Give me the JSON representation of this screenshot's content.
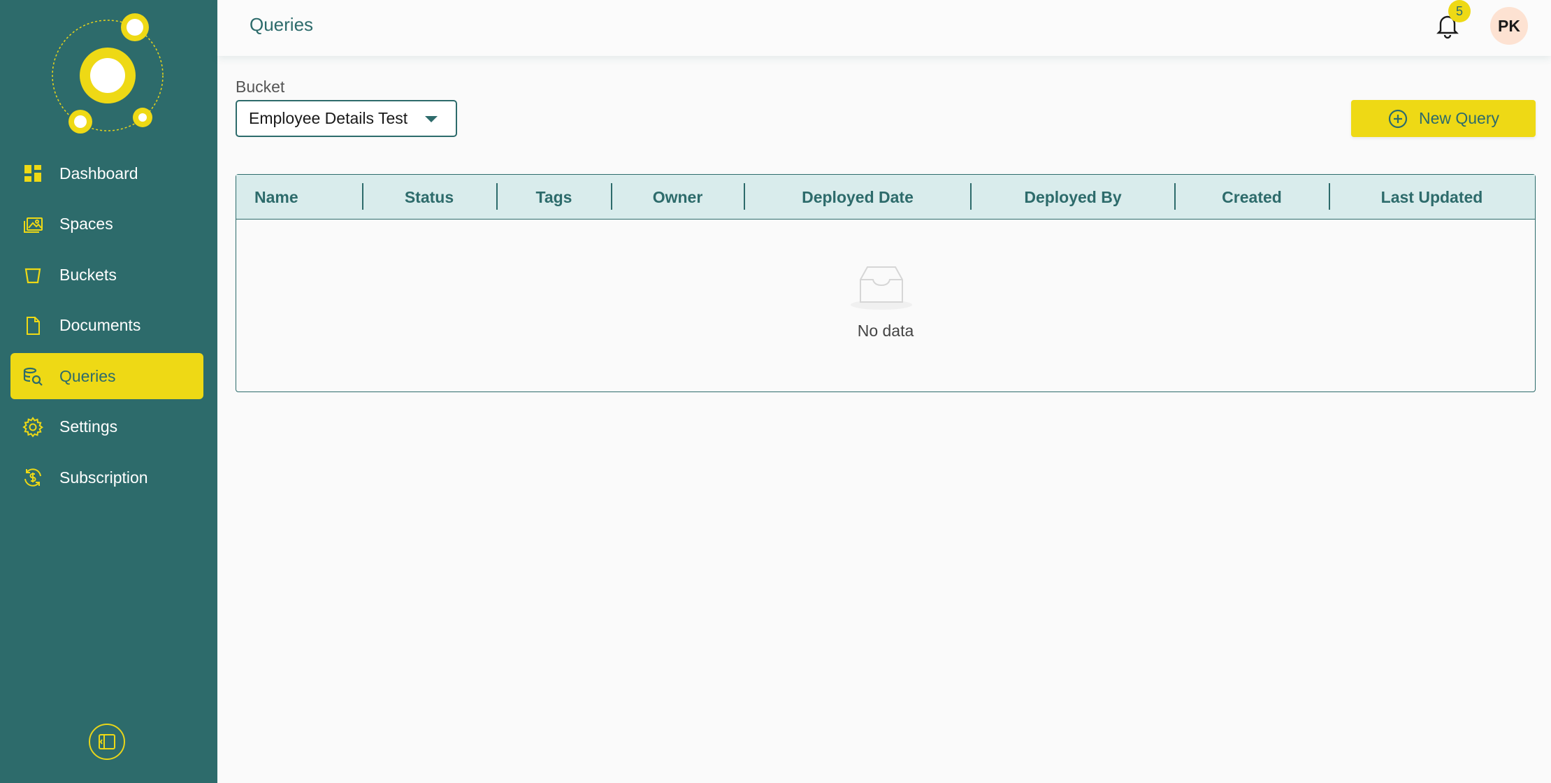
{
  "sidebar": {
    "items": [
      {
        "label": "Dashboard",
        "icon": "dashboard-icon"
      },
      {
        "label": "Spaces",
        "icon": "spaces-icon"
      },
      {
        "label": "Buckets",
        "icon": "bucket-icon"
      },
      {
        "label": "Documents",
        "icon": "document-icon"
      },
      {
        "label": "Queries",
        "icon": "query-search-icon",
        "active": true
      },
      {
        "label": "Settings",
        "icon": "gear-icon"
      },
      {
        "label": "Subscription",
        "icon": "subscription-icon"
      }
    ],
    "collapse_icon": "sidebar-collapse-icon"
  },
  "header": {
    "title": "Queries",
    "notifications_count": "5",
    "avatar_initials": "PK"
  },
  "bucket": {
    "label": "Bucket",
    "selected": "Employee Details Test"
  },
  "actions": {
    "new_query_label": "New Query"
  },
  "table": {
    "columns": [
      "Name",
      "Status",
      "Tags",
      "Owner",
      "Deployed Date",
      "Deployed By",
      "Created",
      "Last Updated"
    ],
    "empty_text": "No data"
  },
  "colors": {
    "primary": "#2d6b6b",
    "accent": "#eed915",
    "avatar_bg": "#fde2d2"
  }
}
